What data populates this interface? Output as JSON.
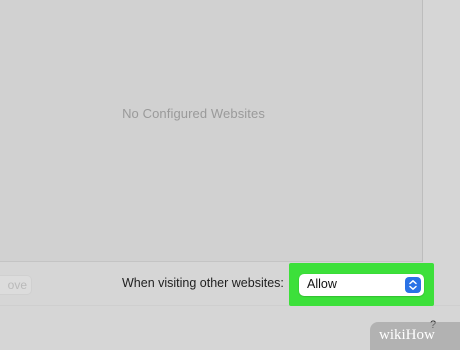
{
  "websites_list": {
    "empty_text": "No Configured Websites"
  },
  "bottom_bar": {
    "remove_label": "ove",
    "visiting_label": "When visiting other websites:",
    "select_value": "Allow",
    "help_label": "?"
  },
  "watermark": {
    "text": "wikiHow"
  },
  "colors": {
    "highlight": "#3ce03a",
    "accent": "#2a72e6"
  },
  "icons": {
    "select_chevron": "chevron-up-down-icon"
  }
}
